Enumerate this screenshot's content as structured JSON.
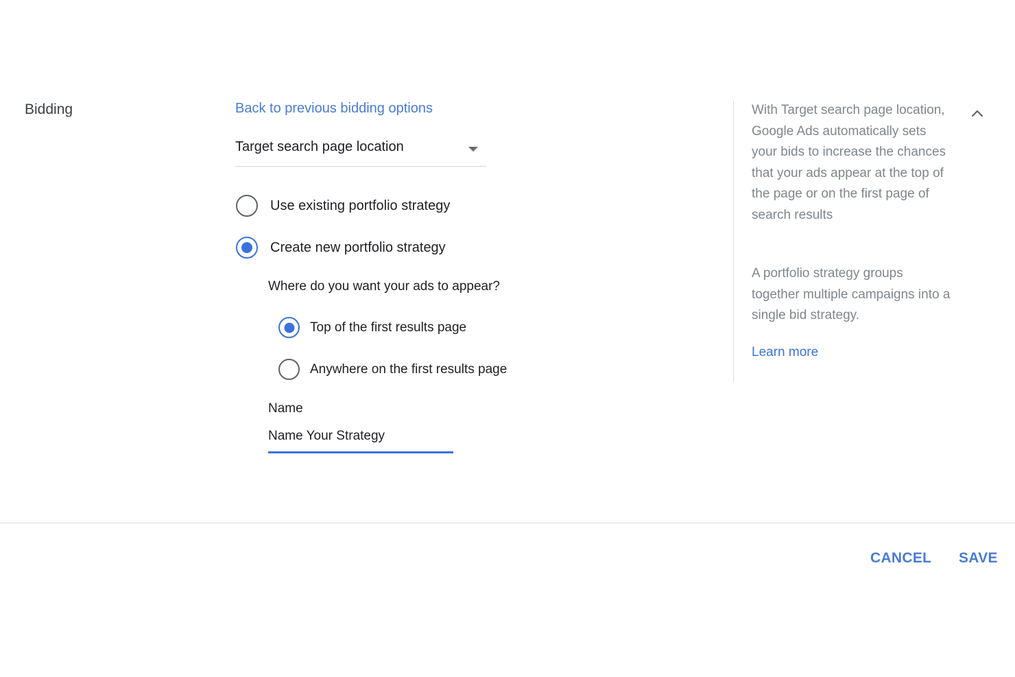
{
  "section": {
    "label": "Bidding"
  },
  "strategy": {
    "back_link": "Back to previous bidding options",
    "selected": "Target search page location",
    "portfolio_options": [
      {
        "label": "Use existing portfolio strategy",
        "checked": false
      },
      {
        "label": "Create new portfolio strategy",
        "checked": true
      }
    ],
    "placement_question": "Where do you want your ads to appear?",
    "placement_options": [
      {
        "label": "Top of the first results page",
        "checked": true
      },
      {
        "label": "Anywhere on the first results page",
        "checked": false
      }
    ],
    "name_label": "Name",
    "name_value": "Name Your Strategy"
  },
  "help": {
    "paragraph1": "With Target search page location, Google Ads automatically sets your bids to increase the chances that your ads appear at the top of the page or on the first page of search results",
    "paragraph2": "A portfolio strategy groups together multiple campaigns into a single bid strategy.",
    "learn_more": "Learn more",
    "collapse_icon": "chevron-up-icon"
  },
  "footer": {
    "cancel_label": "CANCEL",
    "save_label": "SAVE"
  },
  "colors": {
    "accent": "#3b73db",
    "link": "#4a7bd4",
    "help_text": "#80868b",
    "divider": "#dadce0"
  }
}
